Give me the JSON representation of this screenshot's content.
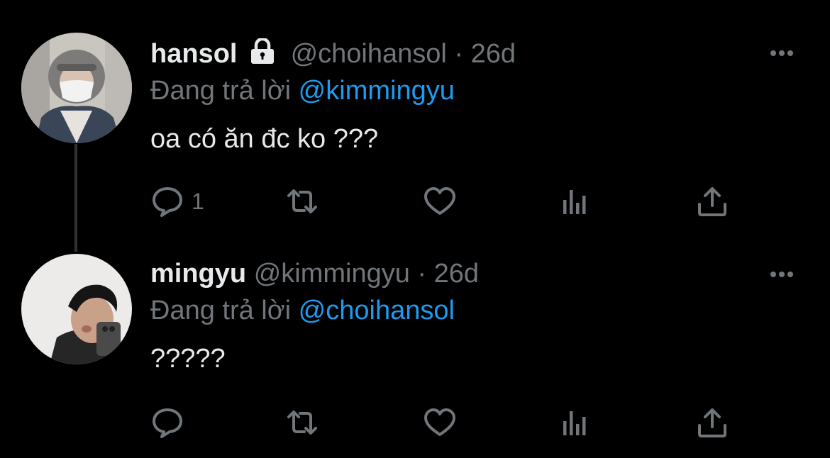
{
  "tweets": [
    {
      "name": "hansol",
      "handle": "@choihansol",
      "separator": "·",
      "time": "26d",
      "replying_prefix": "Đang trả lời",
      "replying_to": "@kimmingyu",
      "text": "oa có ăn đc ko ???",
      "reply_count": "1",
      "locked": true
    },
    {
      "name": "mingyu",
      "handle": "@kimmingyu",
      "separator": "·",
      "time": "26d",
      "replying_prefix": "Đang trả lời",
      "replying_to": "@choihansol",
      "text": "?????",
      "reply_count": "",
      "locked": false
    }
  ],
  "colors": {
    "background": "#000000",
    "text": "#e7e9ea",
    "muted": "#71767b",
    "accent": "#1d9bf0"
  }
}
